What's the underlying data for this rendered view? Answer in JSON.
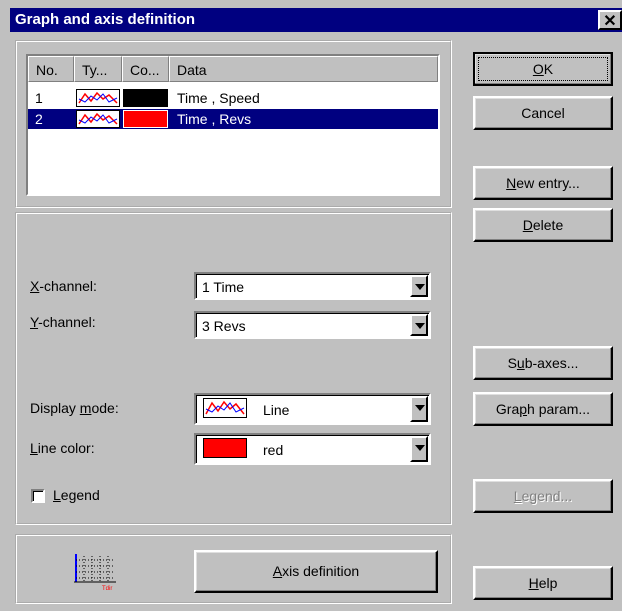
{
  "window": {
    "title": "Graph and axis definition",
    "close_glyph": "✕"
  },
  "list": {
    "columns": [
      "No.",
      "Ty...",
      "Co...",
      "Data"
    ],
    "rows": [
      {
        "no": "1",
        "type_icon": "line-graph-icon",
        "color": "#000000",
        "data": "Time , Speed",
        "selected": false
      },
      {
        "no": "2",
        "type_icon": "line-graph-icon",
        "color": "#ff0000",
        "data": "Time , Revs",
        "selected": true
      }
    ]
  },
  "form": {
    "x_channel": {
      "label_pre": "",
      "label_key": "X",
      "label_post": "-channel:",
      "value": "1  Time"
    },
    "y_channel": {
      "label_pre": "",
      "label_key": "Y",
      "label_post": "-channel:",
      "value": "3  Revs"
    },
    "display_mode": {
      "label_pre": "Display ",
      "label_key": "m",
      "label_post": "ode:",
      "value": "Line",
      "icon": "line-graph-icon"
    },
    "line_color": {
      "label_pre": "",
      "label_key": "L",
      "label_post": "ine color:",
      "value": "red",
      "swatch": "#ff0000"
    },
    "legend": {
      "label_pre": "",
      "label_key": "L",
      "label_post": "egend",
      "checked": false
    }
  },
  "axis": {
    "icon": "axis-grid-icon",
    "icon_caption": "Tdir",
    "button_pre": "",
    "button_key": "A",
    "button_post": "xis definition"
  },
  "buttons": {
    "ok": {
      "pre": "",
      "key": "O",
      "post": "K"
    },
    "cancel": {
      "label": "Cancel"
    },
    "new_entry": {
      "pre": "",
      "key": "N",
      "post": "ew entry..."
    },
    "delete": {
      "pre": "",
      "key": "D",
      "post": "elete"
    },
    "sub_axes": {
      "pre": "S",
      "key": "u",
      "post": "b-axes..."
    },
    "graph_param": {
      "pre": "Gra",
      "key": "p",
      "post": "h param..."
    },
    "legend": {
      "pre": "",
      "key": "L",
      "post": "egend..."
    },
    "help": {
      "pre": "",
      "key": "H",
      "post": "elp"
    }
  }
}
